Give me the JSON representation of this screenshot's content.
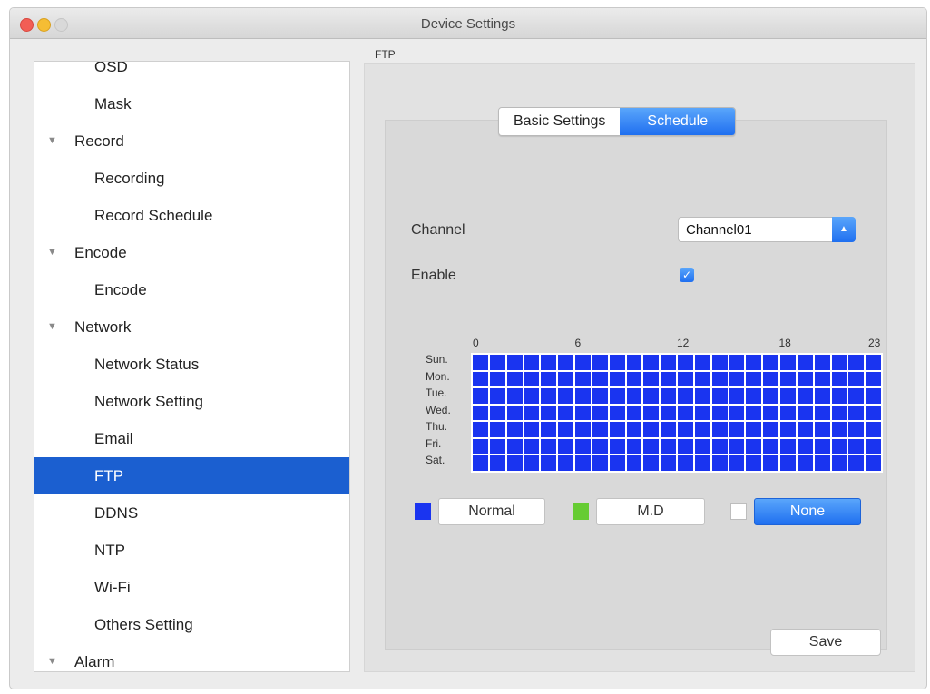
{
  "window": {
    "title": "Device Settings"
  },
  "section_caption": "FTP",
  "sidebar": {
    "items": [
      {
        "label": "OSD",
        "type": "child"
      },
      {
        "label": "Mask",
        "type": "child"
      },
      {
        "label": "Record",
        "type": "group"
      },
      {
        "label": "Recording",
        "type": "child"
      },
      {
        "label": "Record Schedule",
        "type": "child"
      },
      {
        "label": "Encode",
        "type": "group"
      },
      {
        "label": "Encode",
        "type": "child"
      },
      {
        "label": "Network",
        "type": "group"
      },
      {
        "label": "Network Status",
        "type": "child"
      },
      {
        "label": "Network Setting",
        "type": "child"
      },
      {
        "label": "Email",
        "type": "child"
      },
      {
        "label": "FTP",
        "type": "child",
        "selected": true
      },
      {
        "label": "DDNS",
        "type": "child"
      },
      {
        "label": "NTP",
        "type": "child"
      },
      {
        "label": "Wi-Fi",
        "type": "child"
      },
      {
        "label": "Others Setting",
        "type": "child"
      },
      {
        "label": "Alarm",
        "type": "group"
      }
    ]
  },
  "tabs": [
    {
      "label": "Basic Settings",
      "active": false
    },
    {
      "label": "Schedule",
      "active": true
    }
  ],
  "form": {
    "channel_label": "Channel",
    "channel_value": "Channel01",
    "enable_label": "Enable",
    "enable_checked": true
  },
  "schedule": {
    "hour_ticks": [
      "0",
      "6",
      "12",
      "18",
      "23"
    ],
    "days": [
      "Sun.",
      "Mon.",
      "Tue.",
      "Wed.",
      "Thu.",
      "Fri.",
      "Sat."
    ],
    "hours_per_day": 24,
    "fill_mode": "Normal"
  },
  "legend": {
    "normal_label": "Normal",
    "md_label": "M.D",
    "none_label": "None",
    "normal_color": "#1a34f0",
    "md_color": "#66cc33",
    "none_color": "#ffffff"
  },
  "save_label": "Save",
  "colors": {
    "accent": "#1f6ff0",
    "selection": "#1b5fd0"
  }
}
